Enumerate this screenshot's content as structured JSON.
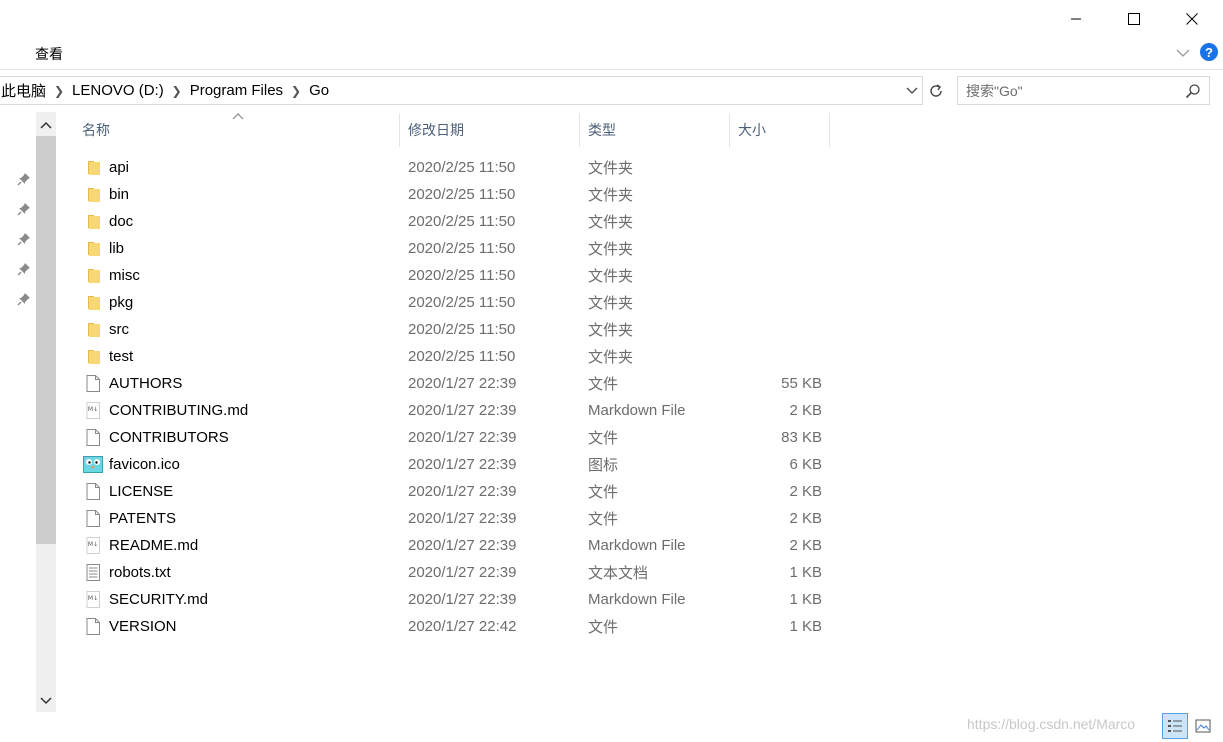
{
  "ribbon": {
    "tab_view": "查看"
  },
  "address": {
    "crumbs": [
      "此电脑",
      "LENOVO (D:)",
      "Program Files",
      "Go"
    ]
  },
  "search": {
    "placeholder": "搜索\"Go\""
  },
  "columns": {
    "name": "名称",
    "date": "修改日期",
    "type": "类型",
    "size": "大小"
  },
  "files": [
    {
      "icon": "folder-icon",
      "name": "api",
      "date": "2020/2/25 11:50",
      "type": "文件夹",
      "size": ""
    },
    {
      "icon": "folder-icon",
      "name": "bin",
      "date": "2020/2/25 11:50",
      "type": "文件夹",
      "size": ""
    },
    {
      "icon": "folder-icon",
      "name": "doc",
      "date": "2020/2/25 11:50",
      "type": "文件夹",
      "size": ""
    },
    {
      "icon": "folder-icon",
      "name": "lib",
      "date": "2020/2/25 11:50",
      "type": "文件夹",
      "size": ""
    },
    {
      "icon": "folder-icon",
      "name": "misc",
      "date": "2020/2/25 11:50",
      "type": "文件夹",
      "size": ""
    },
    {
      "icon": "folder-icon",
      "name": "pkg",
      "date": "2020/2/25 11:50",
      "type": "文件夹",
      "size": ""
    },
    {
      "icon": "folder-icon",
      "name": "src",
      "date": "2020/2/25 11:50",
      "type": "文件夹",
      "size": ""
    },
    {
      "icon": "folder-icon",
      "name": "test",
      "date": "2020/2/25 11:50",
      "type": "文件夹",
      "size": ""
    },
    {
      "icon": "file-icon",
      "name": "AUTHORS",
      "date": "2020/1/27 22:39",
      "type": "文件",
      "size": "55 KB"
    },
    {
      "icon": "markdown-file-icon",
      "name": "CONTRIBUTING.md",
      "date": "2020/1/27 22:39",
      "type": "Markdown File",
      "size": "2 KB"
    },
    {
      "icon": "file-icon",
      "name": "CONTRIBUTORS",
      "date": "2020/1/27 22:39",
      "type": "文件",
      "size": "83 KB"
    },
    {
      "icon": "gopher-ico-icon",
      "name": "favicon.ico",
      "date": "2020/1/27 22:39",
      "type": "图标",
      "size": "6 KB"
    },
    {
      "icon": "file-icon",
      "name": "LICENSE",
      "date": "2020/1/27 22:39",
      "type": "文件",
      "size": "2 KB"
    },
    {
      "icon": "file-icon",
      "name": "PATENTS",
      "date": "2020/1/27 22:39",
      "type": "文件",
      "size": "2 KB"
    },
    {
      "icon": "markdown-file-icon",
      "name": "README.md",
      "date": "2020/1/27 22:39",
      "type": "Markdown File",
      "size": "2 KB"
    },
    {
      "icon": "text-file-icon",
      "name": "robots.txt",
      "date": "2020/1/27 22:39",
      "type": "文本文档",
      "size": "1 KB"
    },
    {
      "icon": "markdown-file-icon",
      "name": "SECURITY.md",
      "date": "2020/1/27 22:39",
      "type": "Markdown File",
      "size": "1 KB"
    },
    {
      "icon": "file-icon",
      "name": "VERSION",
      "date": "2020/1/27 22:42",
      "type": "文件",
      "size": "1 KB"
    }
  ],
  "watermark": "https://blog.csdn.net/Marco",
  "colors": {
    "accent": "#1a73e8",
    "folder": "#f8d775",
    "header_text": "#4c607a",
    "secondary_text": "#6d6d6d"
  }
}
